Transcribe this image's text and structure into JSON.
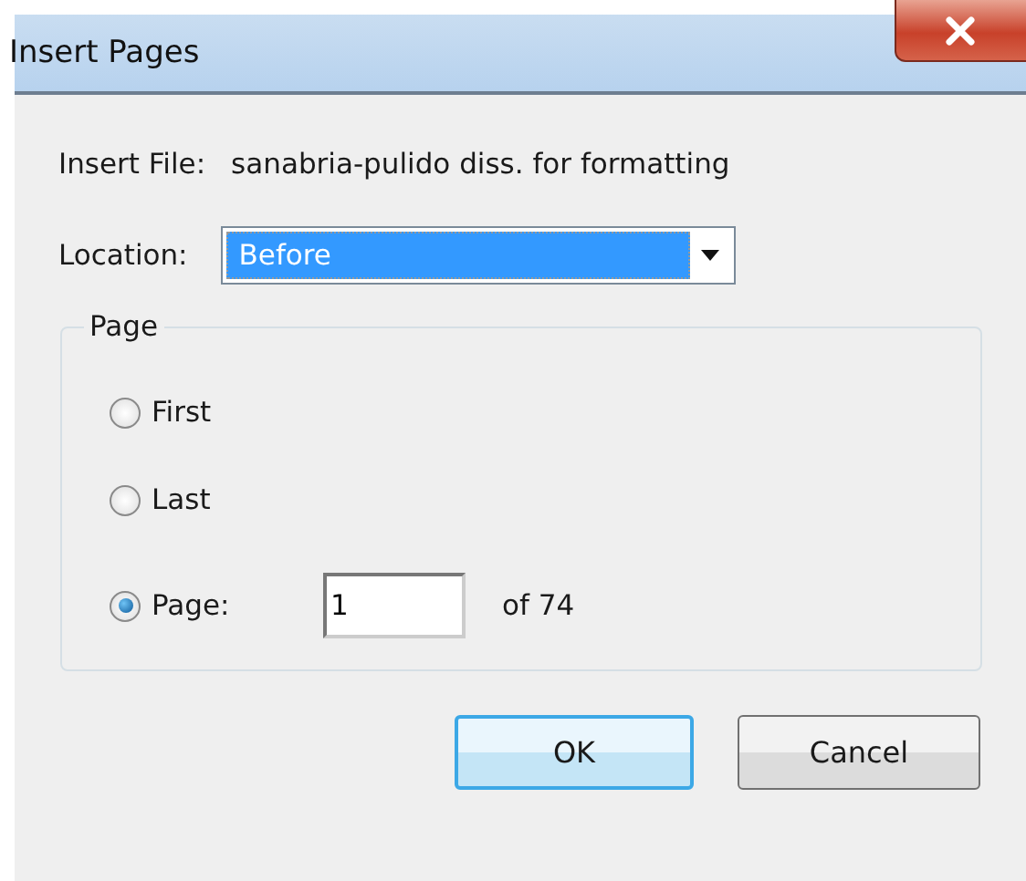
{
  "window": {
    "title": "Insert Pages"
  },
  "insert_file": {
    "label": "Insert File:",
    "value": "sanabria-pulido diss. for formatting"
  },
  "location": {
    "label": "Location:",
    "value": "Before"
  },
  "page_group": {
    "title": "Page",
    "options": [
      {
        "label": "First",
        "selected": false
      },
      {
        "label": "Last",
        "selected": false
      },
      {
        "label": "Page:",
        "selected": true
      }
    ],
    "page_field": {
      "value": "1"
    },
    "of_label": "of 74"
  },
  "buttons": [
    {
      "label": "OK",
      "default": true
    },
    {
      "label": "Cancel",
      "default": false
    }
  ]
}
